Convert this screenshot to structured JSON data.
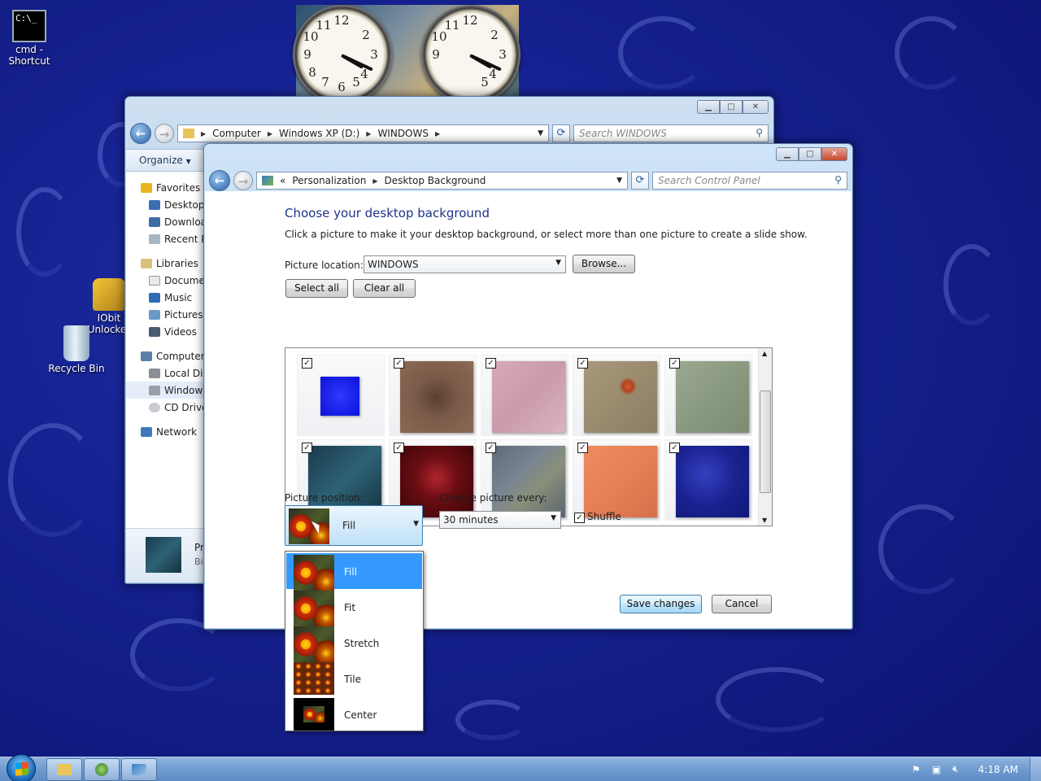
{
  "desktop": {
    "icons": [
      {
        "label": "cmd - Shortcut",
        "icon": "cmd-shortcut-icon"
      },
      {
        "label": "IObit Unlocker",
        "icon": "iobit-unlocker-icon"
      },
      {
        "label": "Recycle Bin",
        "icon": "recycle-bin-icon"
      }
    ]
  },
  "explorer": {
    "breadcrumb": [
      "Computer",
      "Windows XP (D:)",
      "WINDOWS"
    ],
    "search_placeholder": "Search WINDOWS",
    "organize_label": "Organize",
    "nav": [
      {
        "label": "Favorites",
        "icon": "star-icon",
        "level": "top"
      },
      {
        "label": "Desktop",
        "icon": "desktop-icon"
      },
      {
        "label": "Downloads",
        "icon": "downloads-icon"
      },
      {
        "label": "Recent Places",
        "icon": "recent-places-icon"
      },
      {
        "label": "Libraries",
        "icon": "libraries-icon",
        "level": "top"
      },
      {
        "label": "Documents",
        "icon": "documents-icon"
      },
      {
        "label": "Music",
        "icon": "music-icon"
      },
      {
        "label": "Pictures",
        "icon": "pictures-icon"
      },
      {
        "label": "Videos",
        "icon": "videos-icon"
      },
      {
        "label": "Computer",
        "icon": "computer-icon",
        "level": "top"
      },
      {
        "label": "Local Disk",
        "icon": "local-disk-icon"
      },
      {
        "label": "Windows XP (D:)",
        "icon": "drive-icon",
        "selected": true
      },
      {
        "label": "CD Drive",
        "icon": "cd-drive-icon"
      },
      {
        "label": "Network",
        "icon": "network-icon",
        "level": "top"
      }
    ],
    "details_title": "Pr",
    "details_sub": "Bi"
  },
  "control_panel": {
    "breadcrumb_prefix": "«",
    "breadcrumb": [
      "Personalization",
      "Desktop Background"
    ],
    "search_placeholder": "Search Control Panel",
    "heading": "Choose your desktop background",
    "description": "Click a picture to make it your desktop background, or select more than one picture to create a slide show.",
    "picture_location_label": "Picture location:",
    "picture_location_value": "WINDOWS",
    "browse_label": "Browse...",
    "select_all_label": "Select all",
    "clear_all_label": "Clear all",
    "pictures": [
      {
        "name": "blue-square",
        "checked": true,
        "color": "#0a12d8"
      },
      {
        "name": "coffee-stone",
        "checked": true,
        "color": "#7a5a48"
      },
      {
        "name": "pink-paper",
        "checked": true,
        "color": "#c99aab"
      },
      {
        "name": "cave-painting",
        "checked": true,
        "color": "#9a8a6e"
      },
      {
        "name": "green-granite",
        "checked": true,
        "color": "#8a9a80"
      },
      {
        "name": "teal-marble",
        "checked": true,
        "color": "#1d4a5a"
      },
      {
        "name": "red-flowers",
        "checked": true,
        "color": "#6a0d12"
      },
      {
        "name": "grey-camouflage",
        "checked": true,
        "color": "#6c7884"
      },
      {
        "name": "orange-stucco",
        "checked": true,
        "color": "#e57f55"
      },
      {
        "name": "blue-bubbles",
        "checked": true,
        "color": "#1a2290"
      }
    ],
    "picture_position_label": "Picture position:",
    "picture_position_value": "Fill",
    "change_every_label": "Change picture every:",
    "change_every_value": "30 minutes",
    "shuffle_label": "Shuffle",
    "shuffle_checked": true,
    "save_label": "Save changes",
    "cancel_label": "Cancel",
    "position_options": [
      "Fill",
      "Fit",
      "Stretch",
      "Tile",
      "Center"
    ],
    "highlighted_option": "Fill"
  },
  "taskbar": {
    "clock": "4:18 AM",
    "pinned": [
      "explorer-icon",
      "media-player-icon",
      "control-panel-icon"
    ]
  }
}
